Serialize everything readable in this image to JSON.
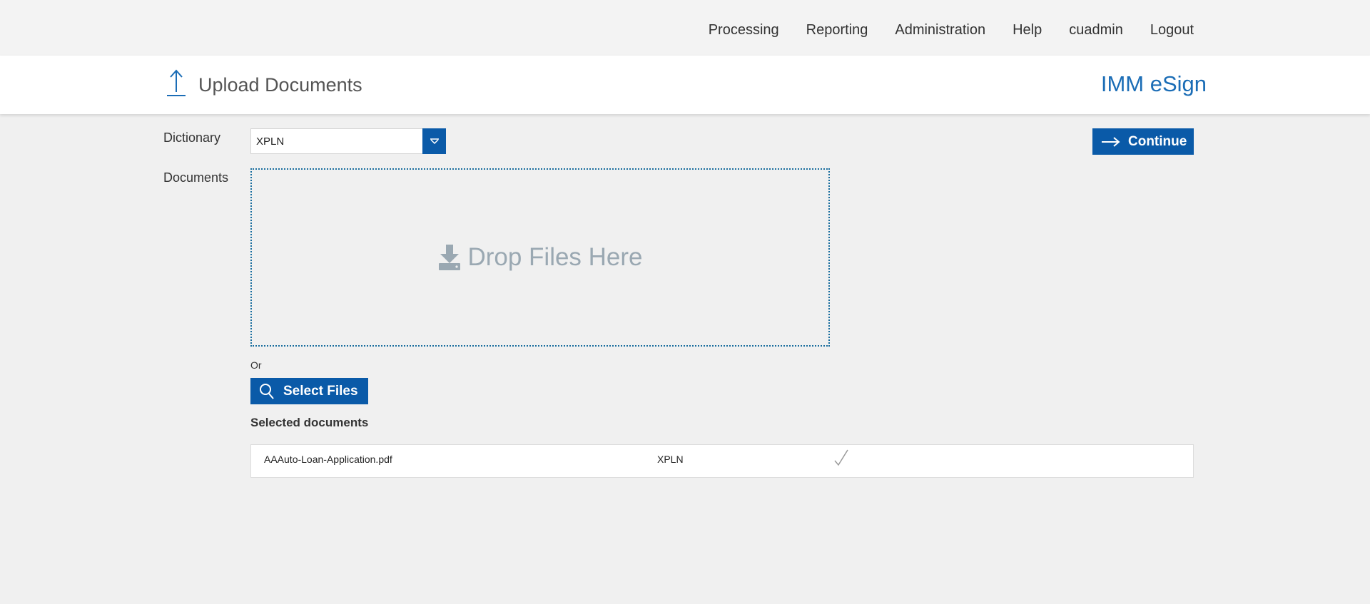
{
  "nav": {
    "items": [
      {
        "label": "Processing"
      },
      {
        "label": "Reporting"
      },
      {
        "label": "Administration"
      },
      {
        "label": "Help"
      },
      {
        "label": "cuadmin"
      },
      {
        "label": "Logout"
      }
    ]
  },
  "header": {
    "title": "Upload Documents",
    "brand": "IMM eSign",
    "icon": "upload-arrow-icon"
  },
  "form": {
    "dictionary_label": "Dictionary",
    "dictionary_value": "XPLN",
    "documents_label": "Documents",
    "dropzone_text": "Drop Files Here",
    "or_text": "Or",
    "select_files_label": "Select Files",
    "continue_label": "Continue"
  },
  "selected": {
    "heading": "Selected documents",
    "rows": [
      {
        "name": "AAAuto-Loan-Application.pdf",
        "dictionary": "XPLN",
        "status_icon": "checkmark-icon"
      }
    ]
  },
  "colors": {
    "accent": "#0a5aa8",
    "brand": "#1b6db6",
    "dropzone_border": "#1a6e9e",
    "dropzone_text": "#9aa8b2"
  }
}
